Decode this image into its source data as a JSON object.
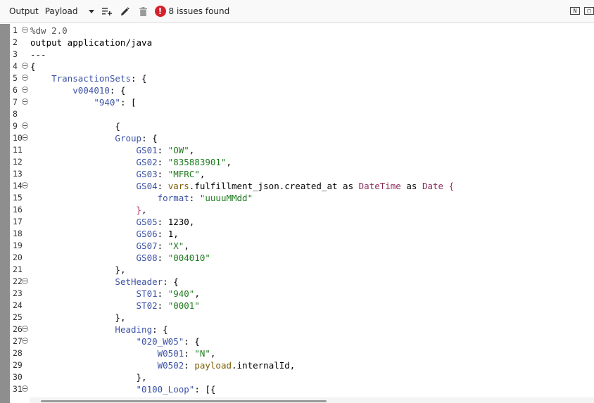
{
  "toolbar": {
    "output_label": "Output",
    "payload_label": "Payload",
    "issues_text": "8 issues found",
    "issue_badge": "!"
  },
  "icons": {
    "dropdown": "chevron-down-icon",
    "add_list": "playlist-add-icon",
    "edit": "pencil-icon",
    "delete": "trash-icon",
    "error": "error-icon",
    "view_split": "split-view-icon",
    "view_single": "single-view-icon"
  },
  "colors": {
    "key": "#3c53a6",
    "string": "#1f7b1f",
    "type": "#8a2a5a",
    "variable": "#7a5c00",
    "error": "#d6212b",
    "gutter": "#8e8e8e"
  },
  "editor": {
    "lines": [
      {
        "num": "1",
        "fold": true,
        "tokens": [
          [
            "comment",
            "%dw 2.0"
          ]
        ]
      },
      {
        "num": "2",
        "fold": false,
        "tokens": [
          [
            "kw",
            "output application/java"
          ]
        ]
      },
      {
        "num": "3",
        "fold": false,
        "tokens": [
          [
            "plain",
            "---"
          ]
        ]
      },
      {
        "num": "4",
        "fold": true,
        "tokens": [
          [
            "punc",
            "{"
          ]
        ]
      },
      {
        "num": "5",
        "fold": true,
        "tokens": [
          [
            "plain",
            "    "
          ],
          [
            "key",
            "TransactionSets"
          ],
          [
            "punc",
            ": {"
          ]
        ]
      },
      {
        "num": "6",
        "fold": true,
        "tokens": [
          [
            "plain",
            "        "
          ],
          [
            "key",
            "v004010"
          ],
          [
            "punc",
            ": {"
          ]
        ]
      },
      {
        "num": "7",
        "fold": true,
        "tokens": [
          [
            "plain",
            "            "
          ],
          [
            "key",
            "\"940\""
          ],
          [
            "punc",
            ": ["
          ]
        ]
      },
      {
        "num": "8",
        "fold": false,
        "tokens": []
      },
      {
        "num": "9",
        "fold": true,
        "tokens": [
          [
            "plain",
            "                "
          ],
          [
            "punc",
            "{"
          ]
        ]
      },
      {
        "num": "10",
        "fold": true,
        "tokens": [
          [
            "plain",
            "                "
          ],
          [
            "key",
            "Group"
          ],
          [
            "punc",
            ": {"
          ]
        ]
      },
      {
        "num": "11",
        "fold": false,
        "tokens": [
          [
            "plain",
            "                    "
          ],
          [
            "key",
            "GS01"
          ],
          [
            "punc",
            ": "
          ],
          [
            "str",
            "\"OW\""
          ],
          [
            "punc",
            ","
          ]
        ]
      },
      {
        "num": "12",
        "fold": false,
        "tokens": [
          [
            "plain",
            "                    "
          ],
          [
            "key",
            "GS02"
          ],
          [
            "punc",
            ": "
          ],
          [
            "str",
            "\"835883901\""
          ],
          [
            "punc",
            ","
          ]
        ]
      },
      {
        "num": "13",
        "fold": false,
        "tokens": [
          [
            "plain",
            "                    "
          ],
          [
            "key",
            "GS03"
          ],
          [
            "punc",
            ": "
          ],
          [
            "str",
            "\"MFRC\""
          ],
          [
            "punc",
            ","
          ]
        ]
      },
      {
        "num": "14",
        "fold": true,
        "tokens": [
          [
            "plain",
            "                    "
          ],
          [
            "key",
            "GS04"
          ],
          [
            "punc",
            ": "
          ],
          [
            "var",
            "vars"
          ],
          [
            "plain",
            ".fulfillment_json.created_at as "
          ],
          [
            "type",
            "DateTime"
          ],
          [
            "plain",
            " as "
          ],
          [
            "type",
            "Date"
          ],
          [
            "brace",
            " {"
          ]
        ]
      },
      {
        "num": "15",
        "fold": false,
        "tokens": [
          [
            "plain",
            "                        "
          ],
          [
            "key",
            "format"
          ],
          [
            "punc",
            ": "
          ],
          [
            "str",
            "\"uuuuMMdd\""
          ]
        ]
      },
      {
        "num": "16",
        "fold": false,
        "tokens": [
          [
            "plain",
            "                    "
          ],
          [
            "brace",
            "}"
          ],
          [
            "punc",
            ","
          ]
        ]
      },
      {
        "num": "17",
        "fold": false,
        "tokens": [
          [
            "plain",
            "                    "
          ],
          [
            "key",
            "GS05"
          ],
          [
            "punc",
            ": "
          ],
          [
            "num",
            "1230"
          ],
          [
            "punc",
            ","
          ]
        ]
      },
      {
        "num": "18",
        "fold": false,
        "tokens": [
          [
            "plain",
            "                    "
          ],
          [
            "key",
            "GS06"
          ],
          [
            "punc",
            ": "
          ],
          [
            "num",
            "1"
          ],
          [
            "punc",
            ","
          ]
        ]
      },
      {
        "num": "19",
        "fold": false,
        "tokens": [
          [
            "plain",
            "                    "
          ],
          [
            "key",
            "GS07"
          ],
          [
            "punc",
            ": "
          ],
          [
            "str",
            "\"X\""
          ],
          [
            "punc",
            ","
          ]
        ]
      },
      {
        "num": "20",
        "fold": false,
        "tokens": [
          [
            "plain",
            "                    "
          ],
          [
            "key",
            "GS08"
          ],
          [
            "punc",
            ": "
          ],
          [
            "str",
            "\"004010\""
          ]
        ]
      },
      {
        "num": "21",
        "fold": false,
        "tokens": [
          [
            "plain",
            "                "
          ],
          [
            "punc",
            "},"
          ]
        ]
      },
      {
        "num": "22",
        "fold": true,
        "tokens": [
          [
            "plain",
            "                "
          ],
          [
            "key",
            "SetHeader"
          ],
          [
            "punc",
            ": {"
          ]
        ]
      },
      {
        "num": "23",
        "fold": false,
        "tokens": [
          [
            "plain",
            "                    "
          ],
          [
            "key",
            "ST01"
          ],
          [
            "punc",
            ": "
          ],
          [
            "str",
            "\"940\""
          ],
          [
            "punc",
            ","
          ]
        ]
      },
      {
        "num": "24",
        "fold": false,
        "tokens": [
          [
            "plain",
            "                    "
          ],
          [
            "key",
            "ST02"
          ],
          [
            "punc",
            ": "
          ],
          [
            "str",
            "\"0001\""
          ]
        ]
      },
      {
        "num": "25",
        "fold": false,
        "tokens": [
          [
            "plain",
            "                "
          ],
          [
            "punc",
            "},"
          ]
        ]
      },
      {
        "num": "26",
        "fold": true,
        "tokens": [
          [
            "plain",
            "                "
          ],
          [
            "key",
            "Heading"
          ],
          [
            "punc",
            ": {"
          ]
        ]
      },
      {
        "num": "27",
        "fold": true,
        "tokens": [
          [
            "plain",
            "                    "
          ],
          [
            "key",
            "\"020_W05\""
          ],
          [
            "punc",
            ": {"
          ]
        ]
      },
      {
        "num": "28",
        "fold": false,
        "tokens": [
          [
            "plain",
            "                        "
          ],
          [
            "key",
            "W0501"
          ],
          [
            "punc",
            ": "
          ],
          [
            "str",
            "\"N\""
          ],
          [
            "punc",
            ","
          ]
        ]
      },
      {
        "num": "29",
        "fold": false,
        "tokens": [
          [
            "plain",
            "                        "
          ],
          [
            "key",
            "W0502"
          ],
          [
            "punc",
            ": "
          ],
          [
            "var",
            "payload"
          ],
          [
            "plain",
            ".internalId,"
          ]
        ]
      },
      {
        "num": "30",
        "fold": false,
        "tokens": [
          [
            "plain",
            "                    "
          ],
          [
            "punc",
            "},"
          ]
        ]
      },
      {
        "num": "31",
        "fold": true,
        "tokens": [
          [
            "plain",
            "                    "
          ],
          [
            "key",
            "\"0100_Loop\""
          ],
          [
            "punc",
            ": [{"
          ]
        ]
      }
    ]
  }
}
